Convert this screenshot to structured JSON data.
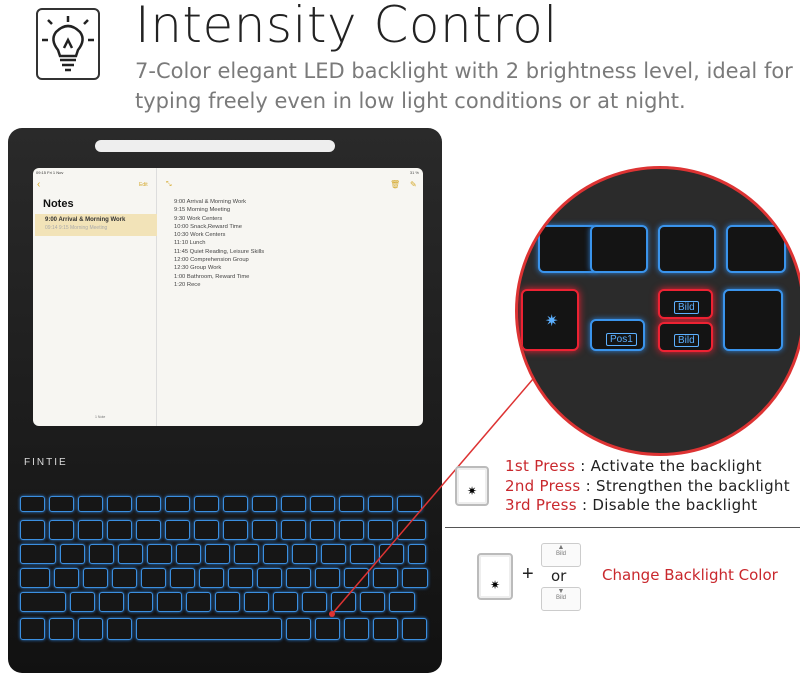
{
  "header": {
    "icon": "lightbulb-icon",
    "title": "Intensity Control",
    "subtitle": "7-Color elegant LED backlight with 2 brightness level, ideal for typing freely even in low light conditions or at night."
  },
  "tablet": {
    "status_time": "09:15  Fri 1 Nov",
    "status_right": "31 %",
    "back_icon": "chevron-left-icon",
    "edit": "Edit",
    "heading": "Notes",
    "selected_note": {
      "title": "9:00 Arrival & Morning Work",
      "subtitle": "09:14   9:15 Morning Meeting"
    },
    "note_count": "1 Note",
    "note_lines": [
      "9:00  Arrival & Morning Work",
      "9:15  Morning Meeting",
      "9:30  Work Centers",
      "10:00 Snack,Reward Time",
      "10:30 Work Centers",
      "11:10 Lunch",
      "11:45 Quiet Reading, Leisure Skills",
      "12:00 Comprehension Group",
      "12:30 Group Work",
      "1:00  Bathroom, Reward Time",
      "1:20  Rece"
    ]
  },
  "keyboard": {
    "brand": "FINTIE",
    "backlight_color": "#3b8fe0"
  },
  "magnifier": {
    "pos1": "Pos1",
    "bild_up": "Bild",
    "bild_down": "Bild",
    "highlight_color": "#e23333"
  },
  "instructions": {
    "presses": [
      {
        "label": "1st Press",
        "text": " : Activate the backlight"
      },
      {
        "label": "2nd Press",
        "text": " : Strengthen the backlight"
      },
      {
        "label": "3rd Press",
        "text": " : Disable the backlight"
      }
    ],
    "plus": "+",
    "or": "or",
    "bild": "Bild",
    "change": "Change Backlight Color",
    "accent": "#c9282d"
  }
}
